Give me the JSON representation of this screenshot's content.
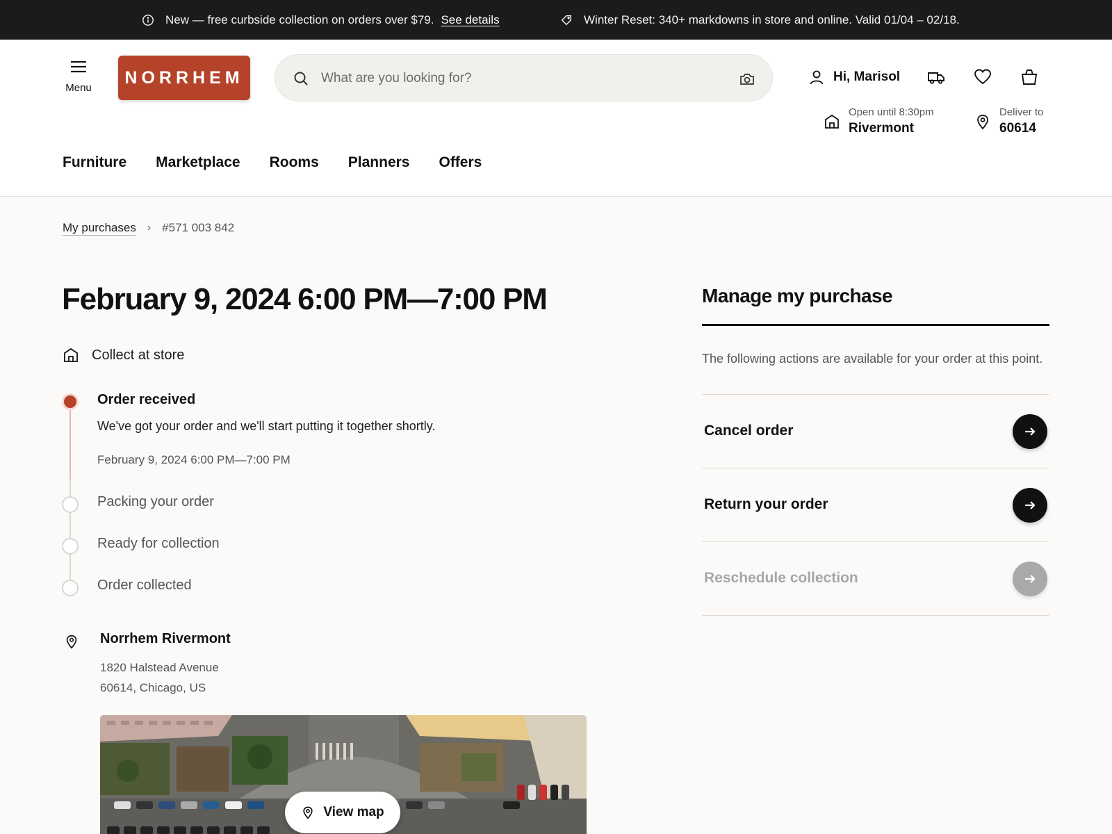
{
  "announcements": {
    "first": {
      "text": "New — free curbside collection on orders over $79.",
      "link": "See details"
    },
    "second": {
      "text": "Winter Reset: 340+ markdowns in store and online. Valid 01/04 – 02/18."
    }
  },
  "header": {
    "menu_label": "Menu",
    "logo_text": "NORRHEM",
    "search_placeholder": "What are you looking for?",
    "greeting": "Hi, Marisol",
    "store": {
      "hours": "Open until 8:30pm",
      "name": "Rivermont"
    },
    "delivery": {
      "label": "Deliver to",
      "zip": "60614"
    },
    "nav": [
      "Furniture",
      "Marketplace",
      "Rooms",
      "Planners",
      "Offers"
    ]
  },
  "breadcrumb": {
    "parent": "My purchases",
    "current": "#571 003 842"
  },
  "order": {
    "title": "February 9, 2024 6:00 PM—7:00 PM",
    "method": "Collect at store",
    "progress": {
      "current_step": 1,
      "total_steps": 4
    },
    "steps": [
      {
        "title": "Order received",
        "desc": "We've got your order and we'll start putting it together shortly.",
        "date": "February 9, 2024 6:00 PM—7:00 PM"
      },
      {
        "title": "Packing your order"
      },
      {
        "title": "Ready for collection"
      },
      {
        "title": "Order collected"
      }
    ],
    "store": {
      "name": "Norrhem Rivermont",
      "address_line1": "1820 Halstead Avenue",
      "address_line2": "60614, Chicago, US"
    },
    "view_map_label": "View map"
  },
  "manage": {
    "title": "Manage my purchase",
    "description": "The following actions are available for your order at this point.",
    "actions": [
      {
        "label": "Cancel order",
        "enabled": true
      },
      {
        "label": "Return your order",
        "enabled": true
      },
      {
        "label": "Reschedule collection",
        "enabled": false
      }
    ]
  },
  "colors": {
    "brand": "#b5432a",
    "topbar": "#1b1b1b",
    "background": "#fbfaf8",
    "action_button": "#111111",
    "disabled": "#a9a9a9"
  }
}
